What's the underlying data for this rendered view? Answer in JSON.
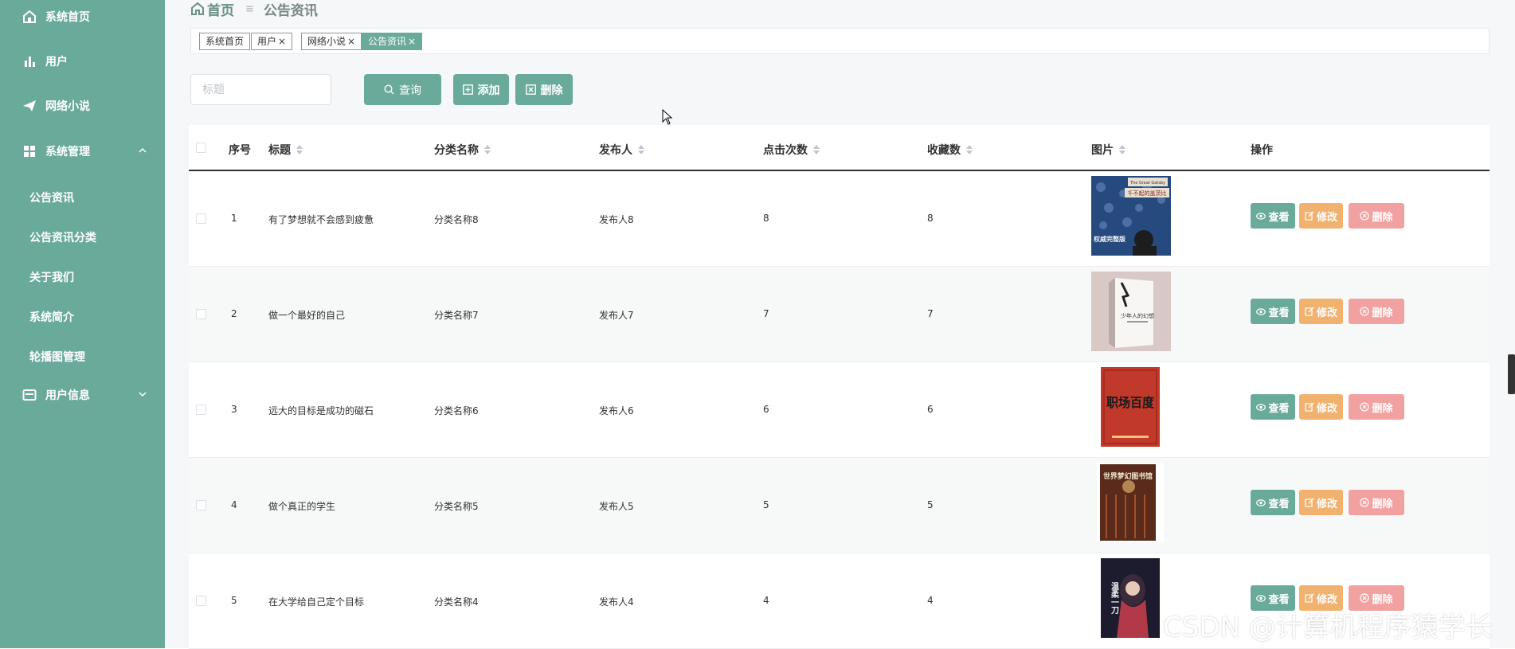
{
  "sidebar": {
    "items": [
      {
        "label": "系统首页",
        "icon": "home-icon"
      },
      {
        "label": "用户",
        "icon": "bar-chart-icon"
      },
      {
        "label": "网络小说",
        "icon": "send-icon"
      },
      {
        "label": "系统管理",
        "icon": "grid-icon",
        "expanded": true
      },
      {
        "label": "用户信息",
        "icon": "id-card-icon",
        "expanded": false
      }
    ],
    "sub_items": [
      "公告资讯",
      "公告资讯分类",
      "关于我们",
      "系统简介",
      "轮播图管理"
    ],
    "bg_color": "#6aaa9b"
  },
  "breadcrumb": {
    "home": "首页",
    "current": "公告资讯"
  },
  "tags": [
    {
      "label": "系统首页"
    },
    {
      "label": "用户"
    },
    {
      "label": "网络小说"
    },
    {
      "label": "公告资讯"
    }
  ],
  "toolbar": {
    "search_placeholder": "标题",
    "search_label": "查询",
    "add_label": "添加",
    "delete_label": "删除"
  },
  "table": {
    "columns": [
      "序号",
      "标题",
      "分类名称",
      "发布人",
      "点击次数",
      "收藏数",
      "图片",
      "操作"
    ],
    "rows": [
      {
        "index": "1",
        "title": "有了梦想就不会感到疲惫",
        "category": "分类名称8",
        "publisher": "发布人8",
        "clicks": "8",
        "favorites": "8",
        "cover": {
          "title": "千不起的盖茨比",
          "tag": "权威完整版",
          "top": "The Great Gatsby",
          "color": "#274a7e"
        }
      },
      {
        "index": "2",
        "title": "做一个最好的自己",
        "category": "分类名称7",
        "publisher": "发布人7",
        "clicks": "7",
        "favorites": "7",
        "cover": {
          "title": "少年人的幻想",
          "tag": "",
          "top": "",
          "color": "#d9c9c6"
        }
      },
      {
        "index": "3",
        "title": "远大的目标是成功的磁石",
        "category": "分类名称6",
        "publisher": "发布人6",
        "clicks": "6",
        "favorites": "6",
        "cover": {
          "title": "职场百度",
          "tag": "",
          "top": "",
          "color": "#c0392b"
        }
      },
      {
        "index": "4",
        "title": "做个真正的学生",
        "category": "分类名称5",
        "publisher": "发布人5",
        "clicks": "5",
        "favorites": "5",
        "cover": {
          "title": "世界梦幻图书馆",
          "tag": "",
          "top": "",
          "color": "#5a2a1a"
        }
      },
      {
        "index": "5",
        "title": "在大学给自己定个目标",
        "category": "分类名称4",
        "publisher": "发布人4",
        "clicks": "4",
        "favorites": "4",
        "cover": {
          "title": "温柔一刀",
          "tag": "",
          "top": "",
          "color": "#1d1b2e"
        }
      }
    ],
    "actions": {
      "view": "查看",
      "edit": "修改",
      "delete": "删除"
    }
  },
  "watermark": "CSDN @计算机程序猿学长",
  "colors": {
    "accent": "#6aaa9b",
    "warning": "#f0b26e",
    "danger": "#f2a1a1"
  }
}
